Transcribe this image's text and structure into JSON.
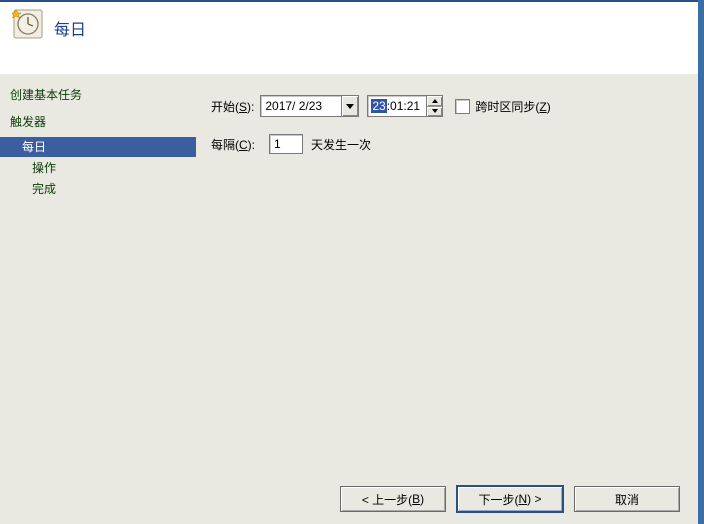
{
  "header": {
    "title": "每日"
  },
  "sidebar": {
    "heading1": "创建基本任务",
    "heading2": "触发器",
    "selected": "每日",
    "item_action": "操作",
    "item_finish": "完成"
  },
  "form": {
    "start_label_pre": "开始(",
    "start_key": "S",
    "start_label_post": "):",
    "date_value": "2017/ 2/23",
    "time_hh": "23",
    "time_rest": ":01:21",
    "sync_label_pre": "跨时区同步(",
    "sync_key": "Z",
    "sync_label_post": ")",
    "interval_label_pre": "每隔(",
    "interval_key": "C",
    "interval_label_post": "):",
    "interval_value": "1",
    "interval_unit": "天发生一次"
  },
  "buttons": {
    "back_pre": "< 上一步(",
    "back_key": "B",
    "back_post": ")",
    "next_pre": "下一步(",
    "next_key": "N",
    "next_post": ") >",
    "cancel": "取消"
  }
}
